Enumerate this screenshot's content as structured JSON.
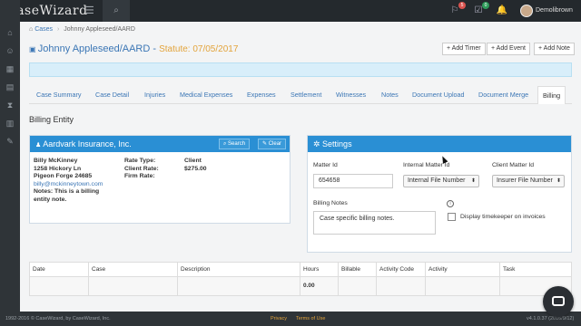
{
  "app": {
    "logo": "CaseWizard",
    "user": "Demolibrown"
  },
  "topbar": {
    "notif_red": "5",
    "notif_green": "0"
  },
  "breadcrumb": {
    "root": "Cases",
    "current": "Johnny Appleseed/AARD"
  },
  "matter": {
    "title": "Johnny Appleseed/AARD",
    "statute": "Statute: 07/05/2017"
  },
  "actions": {
    "add_timer": "+ Add Timer",
    "add_event": "+ Add Event",
    "add_note": "+ Add Note"
  },
  "tabs": [
    "Case Summary",
    "Case Detail",
    "Injuries",
    "Medical Expenses",
    "Expenses",
    "Settlement",
    "Witnesses",
    "Notes",
    "Document Upload",
    "Document Merge",
    "Billing"
  ],
  "section_title": "Billing Entity",
  "entity": {
    "name": "Aardvark Insurance, Inc.",
    "search": "Search",
    "clear": "Clear",
    "contact_name": "Billy McKinney",
    "address1": "1258 Hickory Ln",
    "address2": "Pigeon Forge 24685",
    "email": "billy@mckinneytown.com",
    "note_line1": "Notes: This is a billing",
    "note_line2": "entity note.",
    "rate_type_label": "Rate Type:",
    "rate_type": "Client",
    "client_rate_label": "Client Rate:",
    "client_rate": "$275.00",
    "firm_rate_label": "Firm Rate:"
  },
  "settings": {
    "title": "Settings",
    "matter_id_label": "Matter Id",
    "matter_id": "654658",
    "internal_label": "Internal Matter Id",
    "internal_value": "Internal File Number",
    "client_label": "Client Matter Id",
    "client_value": "Insurer File Number",
    "notes_label": "Billing Notes",
    "notes_value": "Case specific billing notes.",
    "timekeeper_label": "Display timekeeper on invoices"
  },
  "table": {
    "headers": [
      "Date",
      "Case",
      "Description",
      "Hours",
      "Billable",
      "Activity Code",
      "Activity",
      "Task"
    ],
    "total_hours": "0.00"
  },
  "footer": {
    "copyright": "1992-2016 © CaseWizard, by CaseWizard, Inc.",
    "privacy": "Privacy",
    "terms": "Terms of Use",
    "version": "v4.1.0.37 (2016/9/12)"
  },
  "colors": {
    "accent": "#2a8fd4",
    "link": "#3b76b5",
    "statute": "#e3a43c",
    "dark": "#24292d"
  }
}
